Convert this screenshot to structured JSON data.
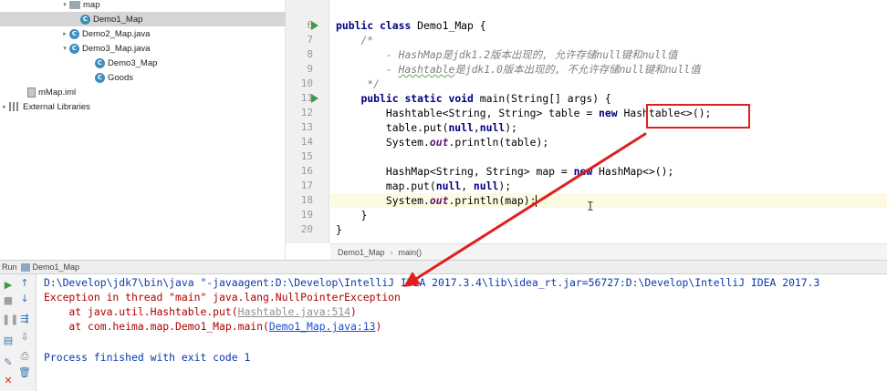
{
  "project_tree": {
    "items": [
      {
        "label": "map",
        "icon": "folder-icon",
        "indent": 76,
        "arrow": "▾"
      },
      {
        "label": "Demo1_Map",
        "icon": "class-icon",
        "indent": 88,
        "arrow": "",
        "selected": true
      },
      {
        "label": "Demo2_Map.java",
        "icon": "class-icon",
        "indent": 76,
        "arrow": "▸"
      },
      {
        "label": "Demo3_Map.java",
        "icon": "class-icon",
        "indent": 76,
        "arrow": "▾"
      },
      {
        "label": "Demo3_Map",
        "icon": "class-icon",
        "indent": 104,
        "arrow": ""
      },
      {
        "label": "Goods",
        "icon": "class-icon",
        "indent": 104,
        "arrow": ""
      },
      {
        "label": "mMap.iml",
        "icon": "iml-icon",
        "indent": 30,
        "arrow": ""
      },
      {
        "label": "External Libraries",
        "icon": "library-icon",
        "indent": 0,
        "arrow": "▸"
      }
    ]
  },
  "editor": {
    "line_numbers": [
      "6",
      "7",
      "8",
      "9",
      "10",
      "11",
      "12",
      "13",
      "14",
      "15",
      "16",
      "17",
      "18",
      "19",
      "20"
    ],
    "run_markers_at": [
      "6",
      "11"
    ],
    "code": {
      "l6_kw1": "public",
      "l6_kw2": "class",
      "l6_name": " Demo1_Map {",
      "l7": "/*",
      "l8": "    - HashMap是jdk1.2版本出现的, 允许存储null键和null值",
      "l9_prefix": "    - ",
      "l9_under": "Hashtable",
      "l9_rest": "是jdk1.0版本出现的, 不允许存储null键和null值",
      "l10": " */",
      "l11_kw1": "public",
      "l11_kw2": "static",
      "l11_kw3": "void",
      "l11_rest": " main(String[] args) {",
      "l12_a": "Hashtable<String, String> table = ",
      "l12_kw": "new",
      "l12_b": " Hashtable<>();",
      "l13_a": "table.put(",
      "l13_kw1": "null",
      "l13_comma": ",",
      "l13_kw2": "null",
      "l13_b": ");",
      "l14_a": "System.",
      "l14_st": "out",
      "l14_b": ".println(table);",
      "l15": "",
      "l16_a": "HashMap<String, String> map = ",
      "l16_kw": "new",
      "l16_b": " HashMap<>();",
      "l17_a": "map.put(",
      "l17_kw1": "null",
      "l17_comma": ", ",
      "l17_kw2": "null",
      "l17_b": ");",
      "l18_a": "System.",
      "l18_st": "out",
      "l18_b": ".println(map);",
      "l19": "}",
      "l20": "}"
    },
    "text_cursor_glyph": "I",
    "breadcrumb": [
      "Demo1_Map",
      "main()"
    ],
    "breadcrumb_sep": "›"
  },
  "run_panel": {
    "header_label": "Run",
    "tab_label": "Demo1_Map",
    "console": {
      "cmd": "D:\\Develop\\jdk7\\bin\\java \"-javaagent:D:\\Develop\\IntelliJ IDEA 2017.3.4\\lib\\idea_rt.jar=56727:D:\\Develop\\IntelliJ IDEA 2017.3",
      "exception": "Exception in thread \"main\" java.lang.NullPointerException",
      "trace1_a": "    at java.util.Hashtable.put(",
      "trace1_link": "Hashtable.java:514",
      "trace1_b": ")",
      "trace2_a": "    at com.heima.map.Demo1_Map.main(",
      "trace2_link": "Demo1_Map.java:13",
      "trace2_b": ")",
      "exit": "Process finished with exit code 1"
    }
  },
  "colors": {
    "annotation_red": "#e02020",
    "error_text": "#b00000",
    "keyword": "#000080"
  }
}
